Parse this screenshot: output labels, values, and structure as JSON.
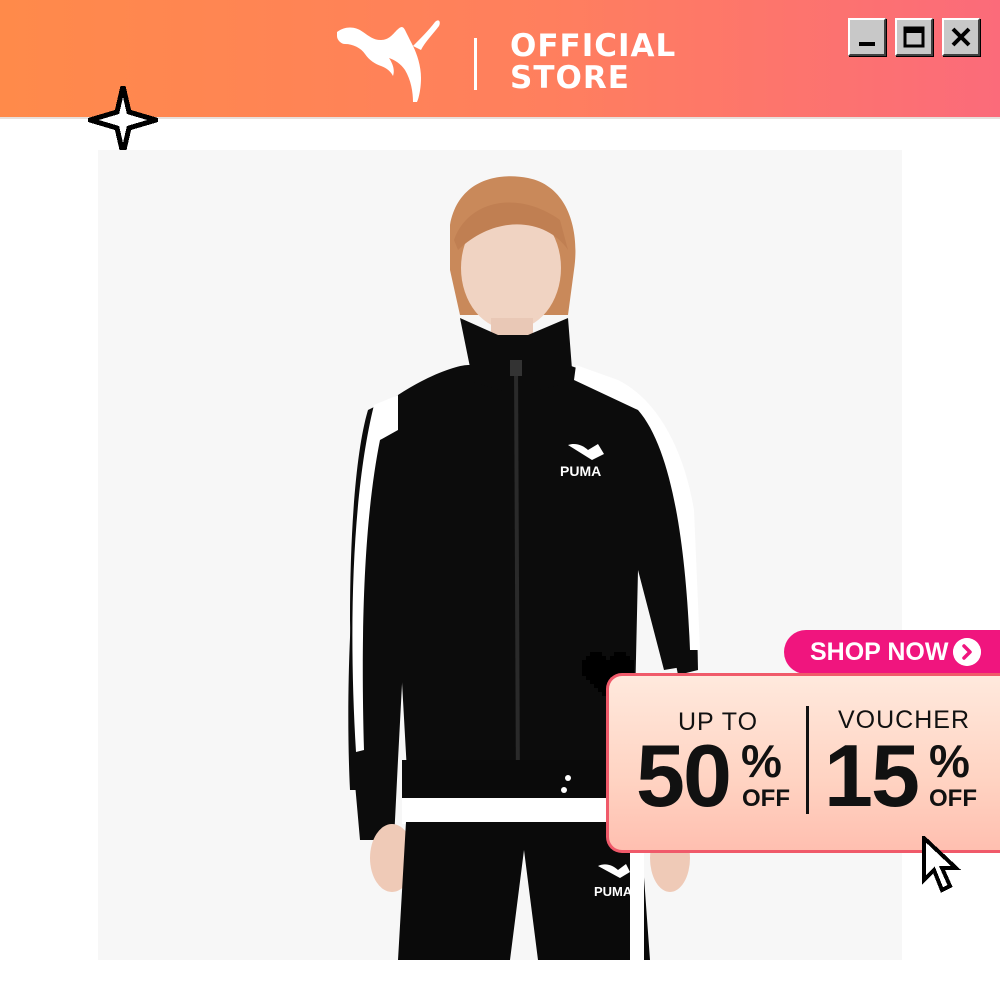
{
  "header": {
    "brand_logo": "puma-cat-icon",
    "store_line1": "OFFICIAL",
    "store_line2": "STORE",
    "window_controls": [
      "minimize-icon",
      "maximize-icon",
      "close-icon"
    ]
  },
  "product": {
    "chest_logo_text": "PUMA",
    "pants_logo_text": "PUMA"
  },
  "promo": {
    "cta_label": "SHOP NOW",
    "cta_icon": "chevron-right-icon",
    "left_label": "UP TO",
    "left_value": "50",
    "left_pct": "%",
    "left_off": "OFF",
    "right_label": "VOUCHER",
    "right_value": "15",
    "right_pct": "%",
    "right_off": "OFF"
  },
  "decorations": [
    "sparkle-icon",
    "heart-icon",
    "cursor-icon"
  ],
  "colors": {
    "header_start": "#ff8a4a",
    "header_end": "#fb6b7a",
    "cta_pink": "#f0157e",
    "promo_border": "#f05a6a"
  }
}
